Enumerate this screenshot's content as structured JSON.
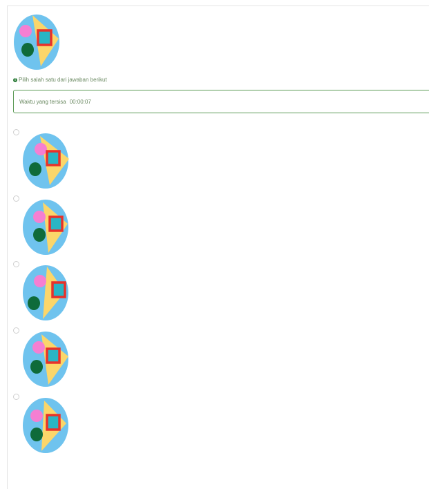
{
  "question": {
    "image_icon": "shapes-circle-image",
    "instruction": "Pilih salah satu dari jawaban berikut",
    "info_icon": "info-icon"
  },
  "timer": {
    "label": "Waktu yang tersisa",
    "value": "00:00:07"
  },
  "colors": {
    "circle_bg": "#6fc3ee",
    "triangle": "#fbd66a",
    "pink": "#f57fd2",
    "green": "#0f6b3a",
    "square_border": "#e8312a",
    "square_fill": "#2ab5c4",
    "accent_green": "#5b9a55"
  },
  "options": [
    {
      "id": "a",
      "image_icon": "shapes-circle-image",
      "selected": false
    },
    {
      "id": "b",
      "image_icon": "shapes-circle-image",
      "selected": false
    },
    {
      "id": "c",
      "image_icon": "shapes-circle-image",
      "selected": false
    },
    {
      "id": "d",
      "image_icon": "shapes-circle-image",
      "selected": false
    },
    {
      "id": "e",
      "image_icon": "shapes-circle-image",
      "selected": false
    }
  ]
}
